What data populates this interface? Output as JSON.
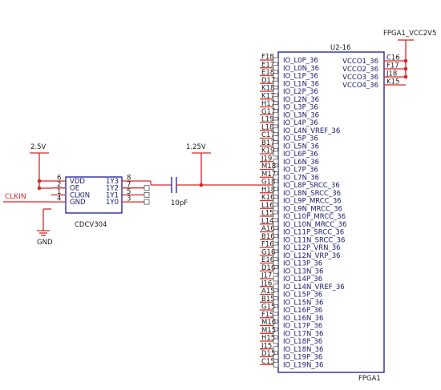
{
  "supply": {
    "left_net": "2.5V",
    "mid_net": "1.25V",
    "fpga_vcc_net": "FPGA1_VCC2V5",
    "gnd_net": "GND"
  },
  "signal": {
    "clkin_net": "CLKIN"
  },
  "capacitor": {
    "value": "10pF"
  },
  "buffer": {
    "part": "CDCV304",
    "left_pins": [
      {
        "num": "6",
        "name": "VDD"
      },
      {
        "num": "2",
        "name": "OE"
      },
      {
        "num": "1",
        "name": "CLKIN"
      },
      {
        "num": "4",
        "name": "GND"
      }
    ],
    "right_pins": [
      {
        "num": "8",
        "name": "1Y3"
      },
      {
        "num": "7",
        "name": "1Y2"
      },
      {
        "num": "5",
        "name": "1Y1"
      },
      {
        "num": "3",
        "name": "1Y0"
      }
    ]
  },
  "fpga": {
    "designator": "U2-16",
    "name": "FPGA1",
    "left_pins": [
      {
        "num": "F18",
        "name": "IO_L0P_36"
      },
      {
        "num": "E17",
        "name": "IO_L0N_36"
      },
      {
        "num": "E18",
        "name": "IO_L1P_36"
      },
      {
        "num": "D17",
        "name": "IO_L1N_36"
      },
      {
        "num": "K18",
        "name": "IO_L2P_36"
      },
      {
        "num": "K17",
        "name": "IO_L2N_36"
      },
      {
        "num": "H17",
        "name": "IO_L3P_36"
      },
      {
        "num": "G17",
        "name": "IO_L3N_36"
      },
      {
        "num": "L19",
        "name": "IO_L4P_36"
      },
      {
        "num": "L18",
        "name": "IO_L4N_VREF_36"
      },
      {
        "num": "C17",
        "name": "IO_L5P_36"
      },
      {
        "num": "B17",
        "name": "IO_L5N_36"
      },
      {
        "num": "K19",
        "name": "IO_L6P_36"
      },
      {
        "num": "J19",
        "name": "IO_L6N_36"
      },
      {
        "num": "M18",
        "name": "IO_L7P_36"
      },
      {
        "num": "M17",
        "name": "IO_L7N_36"
      },
      {
        "num": "G18",
        "name": "IO_L8P_SRCC_36"
      },
      {
        "num": "H18",
        "name": "IO_L8N_SRCC_36"
      },
      {
        "num": "K16",
        "name": "IO_L9P_MRCC_36"
      },
      {
        "num": "L16",
        "name": "IO_L9N_MRCC_36"
      },
      {
        "num": "L15",
        "name": "IO_L10P_MRCC_36"
      },
      {
        "num": "L14",
        "name": "IO_L10N_MRCC_36"
      },
      {
        "num": "A16",
        "name": "IO_L11P_SRCC_36"
      },
      {
        "num": "B16",
        "name": "IO_L11N_SRCC_36"
      },
      {
        "num": "F16",
        "name": "IO_L12P_VRN_36"
      },
      {
        "num": "G16",
        "name": "IO_L12N_VRP_36"
      },
      {
        "num": "E16",
        "name": "IO_L13P_36"
      },
      {
        "num": "D16",
        "name": "IO_L13N_36"
      },
      {
        "num": "J17",
        "name": "IO_L14P_36"
      },
      {
        "num": "J16",
        "name": "IO_L14N_VREF_36"
      },
      {
        "num": "A15",
        "name": "IO_L15P_36"
      },
      {
        "num": "B15",
        "name": "IO_L15N_36"
      },
      {
        "num": "G15",
        "name": "IO_L16P_36"
      },
      {
        "num": "F15",
        "name": "IO_L16N_36"
      },
      {
        "num": "M16",
        "name": "IO_L17P_36"
      },
      {
        "num": "M15",
        "name": "IO_L17N_36"
      },
      {
        "num": "H15",
        "name": "IO_L18P_36"
      },
      {
        "num": "J15",
        "name": "IO_L18N_36"
      },
      {
        "num": "D15",
        "name": "IO_L19P_36"
      },
      {
        "num": "C15",
        "name": "IO_L19N_36"
      }
    ],
    "right_pins": [
      {
        "num": "C16",
        "name": "VCCO1_36"
      },
      {
        "num": "F17",
        "name": "VCCO2_36"
      },
      {
        "num": "J18",
        "name": "VCCO3_36"
      },
      {
        "num": "K15",
        "name": "VCCO4_36"
      }
    ]
  }
}
